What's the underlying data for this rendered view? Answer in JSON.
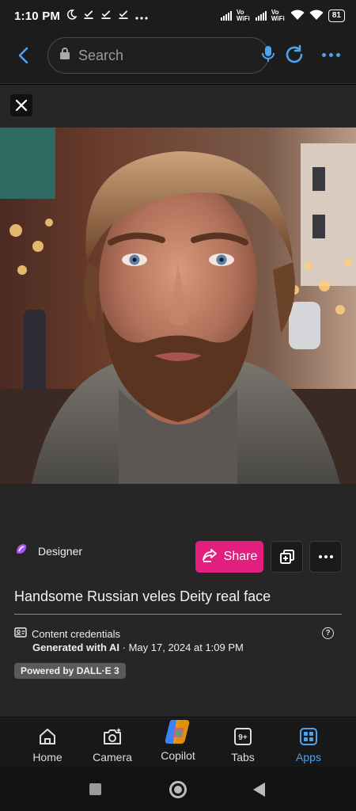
{
  "status_bar": {
    "time": "1:10 PM",
    "net_label_1": "Vo WiFi",
    "net_label_2": "Vo WiFi",
    "battery": "81"
  },
  "browser": {
    "search_placeholder": "Search",
    "accent": "#4ea3f0"
  },
  "image": {
    "icon": "generated-portrait-image"
  },
  "card": {
    "source_label": "Designer",
    "share_label": "Share",
    "share_color": "#e21f7f",
    "title": "Handsome Russian veles Deity real face",
    "credentials_label": "Content credentials",
    "generated_bold": "Generated with AI",
    "generated_rest": " · May 17, 2024 at 1:09 PM",
    "powered_label": "Powered by DALL·E 3"
  },
  "tabs": [
    {
      "label": "Home",
      "icon": "home-icon"
    },
    {
      "label": "Camera",
      "icon": "camera-icon"
    },
    {
      "label": "Copilot",
      "icon": "copilot-icon"
    },
    {
      "label": "Tabs",
      "icon": "tabs-icon",
      "badge": "9+"
    },
    {
      "label": "Apps",
      "icon": "apps-icon",
      "active": true
    }
  ]
}
